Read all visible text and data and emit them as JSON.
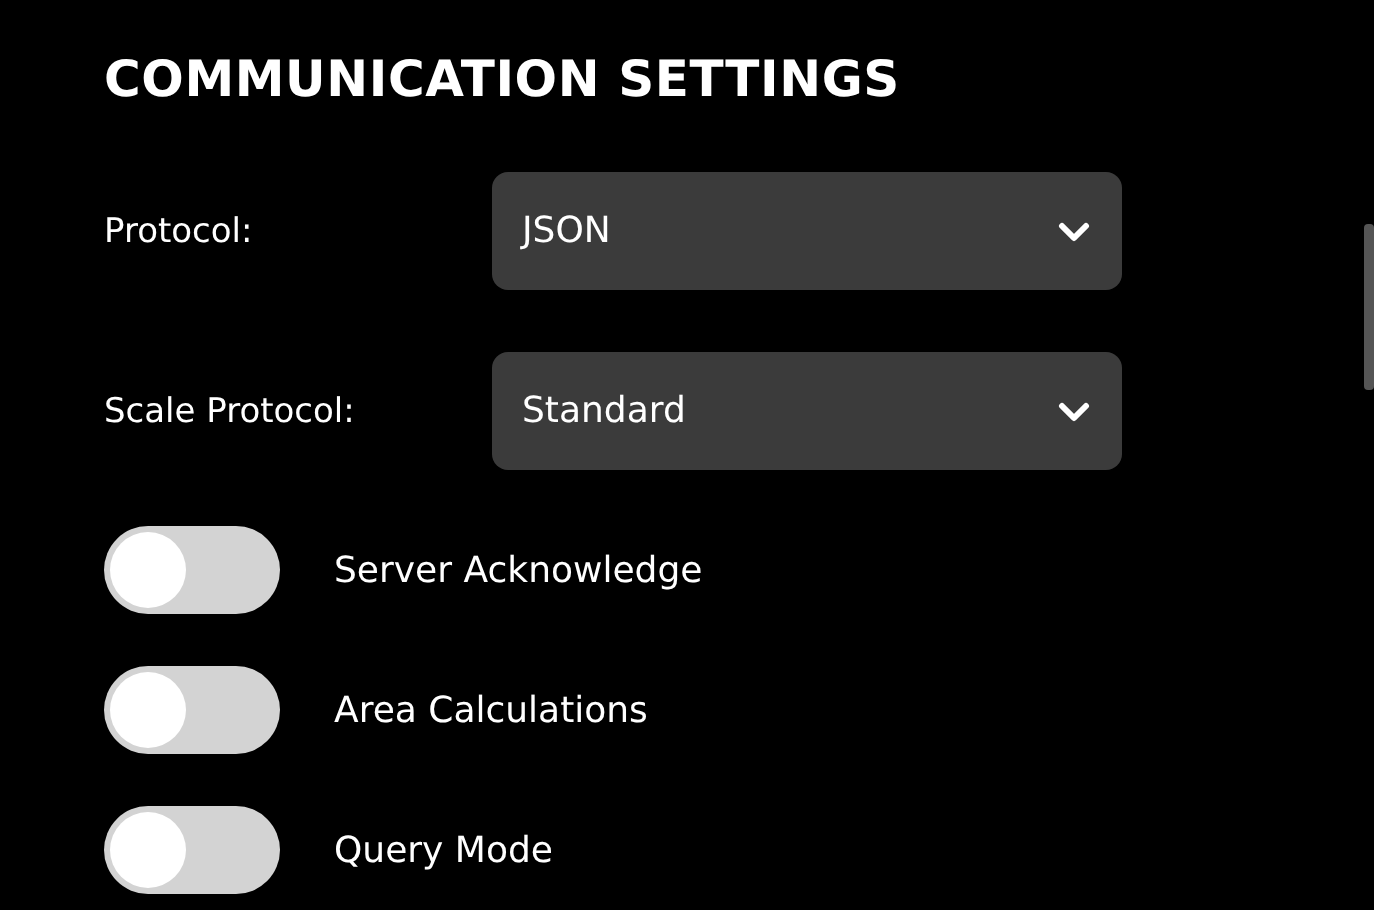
{
  "title": "COMMUNICATION SETTINGS",
  "selects": [
    {
      "label": "Protocol:",
      "value": "JSON"
    },
    {
      "label": "Scale Protocol:",
      "value": "Standard"
    }
  ],
  "toggles": [
    {
      "label": "Server Acknowledge",
      "on": false
    },
    {
      "label": "Area Calculations",
      "on": false
    },
    {
      "label": "Query Mode",
      "on": false
    }
  ]
}
